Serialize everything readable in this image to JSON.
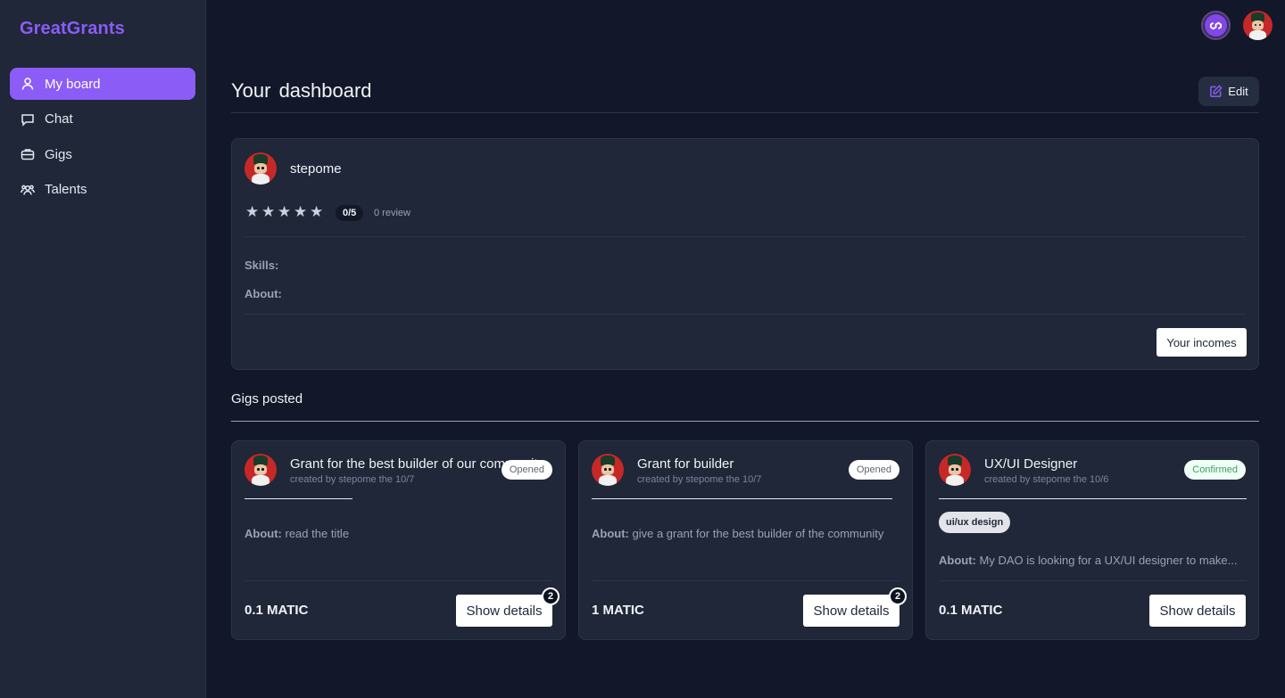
{
  "brand": {
    "name": "GreatGrants",
    "color": "#8b5cf6"
  },
  "sidebar": {
    "items": [
      {
        "label": "My board",
        "icon": "user-icon",
        "active": true
      },
      {
        "label": "Chat",
        "icon": "chat-bubble-icon",
        "active": false
      },
      {
        "label": "Gigs",
        "icon": "briefcase-icon",
        "active": false
      },
      {
        "label": "Talents",
        "icon": "users-icon",
        "active": false
      }
    ]
  },
  "topbar": {
    "network_icon": "polygon-icon",
    "avatar_icon": "avatar"
  },
  "header": {
    "title": "Your dashboard",
    "edit_label": "Edit"
  },
  "profile": {
    "username": "stepome",
    "rating": "0/5",
    "rating_value": 0,
    "rating_max": 5,
    "review_count": "0 review",
    "skills_label": "Skills:",
    "about_label": "About:",
    "incomes_label": "Your incomes"
  },
  "gigs": {
    "section_title": "Gigs posted",
    "items": [
      {
        "title": "Grant for the best builder of our community",
        "subtitle": "created by stepome the 10/7",
        "status": "Opened",
        "tag": "",
        "about_label": "About:",
        "about": "read the title",
        "price": "0.1 MATIC",
        "details_label": "Show details",
        "notification_count": "2"
      },
      {
        "title": "Grant for builder",
        "subtitle": "created by stepome the 10/7",
        "status": "Opened",
        "tag": "",
        "about_label": "About:",
        "about": "give a grant for the best builder of the community",
        "price": "1 MATIC",
        "details_label": "Show details",
        "notification_count": "2"
      },
      {
        "title": "UX/UI Designer",
        "subtitle": "created by stepome the 10/6",
        "status": "Confirmed",
        "tag": "ui/ux design",
        "about_label": "About:",
        "about": "My DAO is looking for a UX/UI designer to make...",
        "price": "0.1 MATIC",
        "details_label": "Show details",
        "notification_count": ""
      }
    ]
  },
  "colors": {
    "background": "#121829",
    "card": "#1f2738",
    "accent": "#8b5cf6",
    "confirmed": "#38a169"
  }
}
